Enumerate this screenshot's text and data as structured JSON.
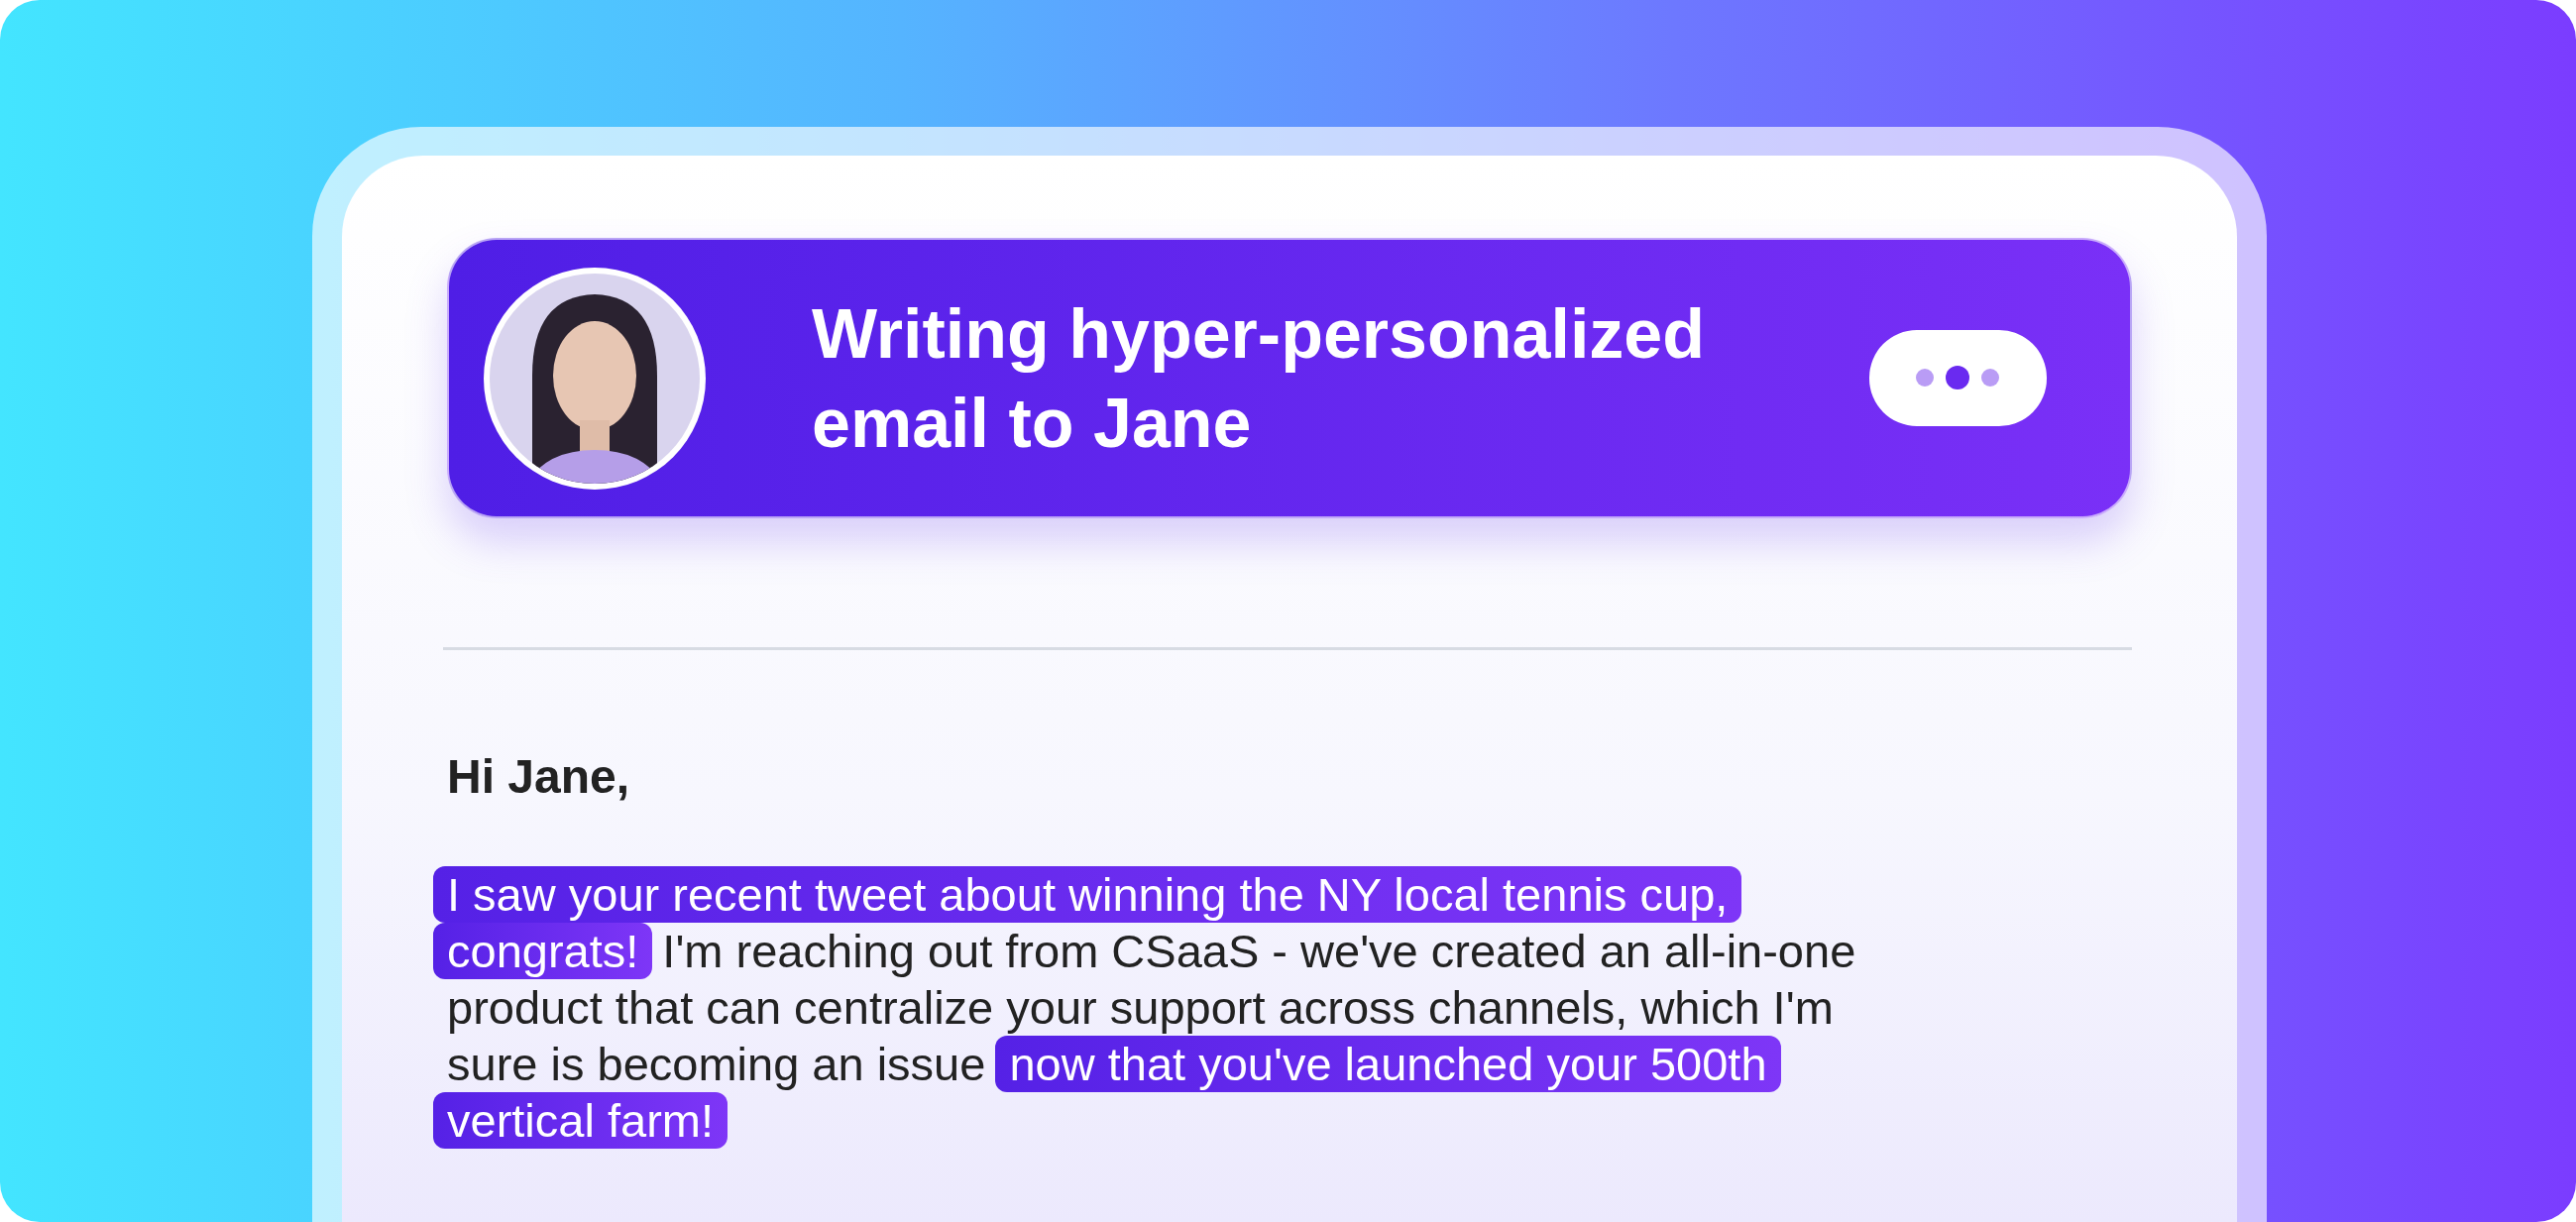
{
  "banner": {
    "title": "Writing hyper-personalized email to Jane"
  },
  "email": {
    "greeting": "Hi Jane,",
    "lines": [
      {
        "segments": [
          {
            "text": "I saw your recent tweet about winning the NY local tennis cup,",
            "highlighted": true
          }
        ]
      },
      {
        "segments": [
          {
            "text": "congrats!",
            "highlighted": true
          },
          {
            "text": "I'm reaching out from CSaaS - we've created an all-in-one",
            "highlighted": false
          }
        ]
      },
      {
        "segments": [
          {
            "text": "product that can centralize your support across channels, which I'm",
            "highlighted": false
          }
        ]
      },
      {
        "segments": [
          {
            "text": "sure is becoming an issue",
            "highlighted": false
          },
          {
            "text": "now that you've launched your 500th",
            "highlighted": true
          }
        ]
      },
      {
        "segments": [
          {
            "text": "vertical farm!",
            "highlighted": true
          }
        ]
      }
    ]
  }
}
